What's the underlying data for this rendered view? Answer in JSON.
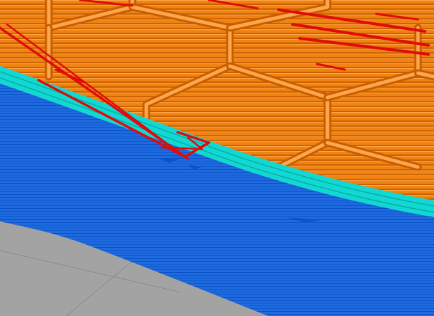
{
  "viewport": {
    "kind": "slicer-gcode-preview-3d",
    "feature_colors": {
      "bed": "#a3a3a3",
      "bed_grid": "#8c8c8c",
      "outer_wall": "#1e6be0",
      "outer_wall_dark": "#0d52c7",
      "inner_wall": "#12d8d2",
      "inner_wall_dark": "#0aa8a6",
      "infill": "#f0820f",
      "infill_dark": "#c75e00",
      "infill_light": "#ffa64d",
      "travel": "#e00b0b",
      "travel_dark": "#a30000"
    },
    "infill_pattern": "honeycomb"
  }
}
